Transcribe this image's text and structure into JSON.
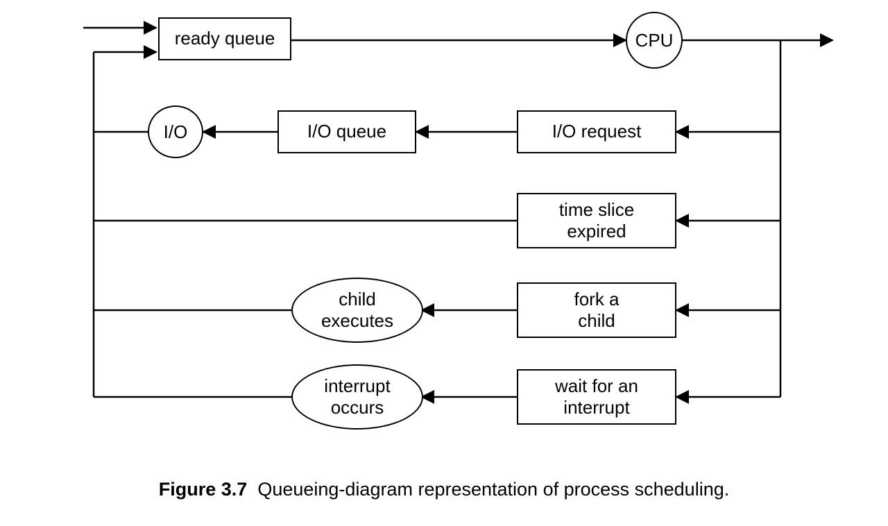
{
  "figure": {
    "number": "Figure 3.7",
    "caption": "Queueing-diagram representation of process scheduling."
  },
  "nodes": {
    "ready_queue": "ready queue",
    "cpu": "CPU",
    "io": "I/O",
    "io_queue": "I/O queue",
    "io_request": "I/O request",
    "time_slice": "time slice\nexpired",
    "child_exec": "child\nexecutes",
    "fork_child": "fork a\nchild",
    "interrupt_occurs": "interrupt\noccurs",
    "wait_interrupt": "wait for an\ninterrupt"
  }
}
